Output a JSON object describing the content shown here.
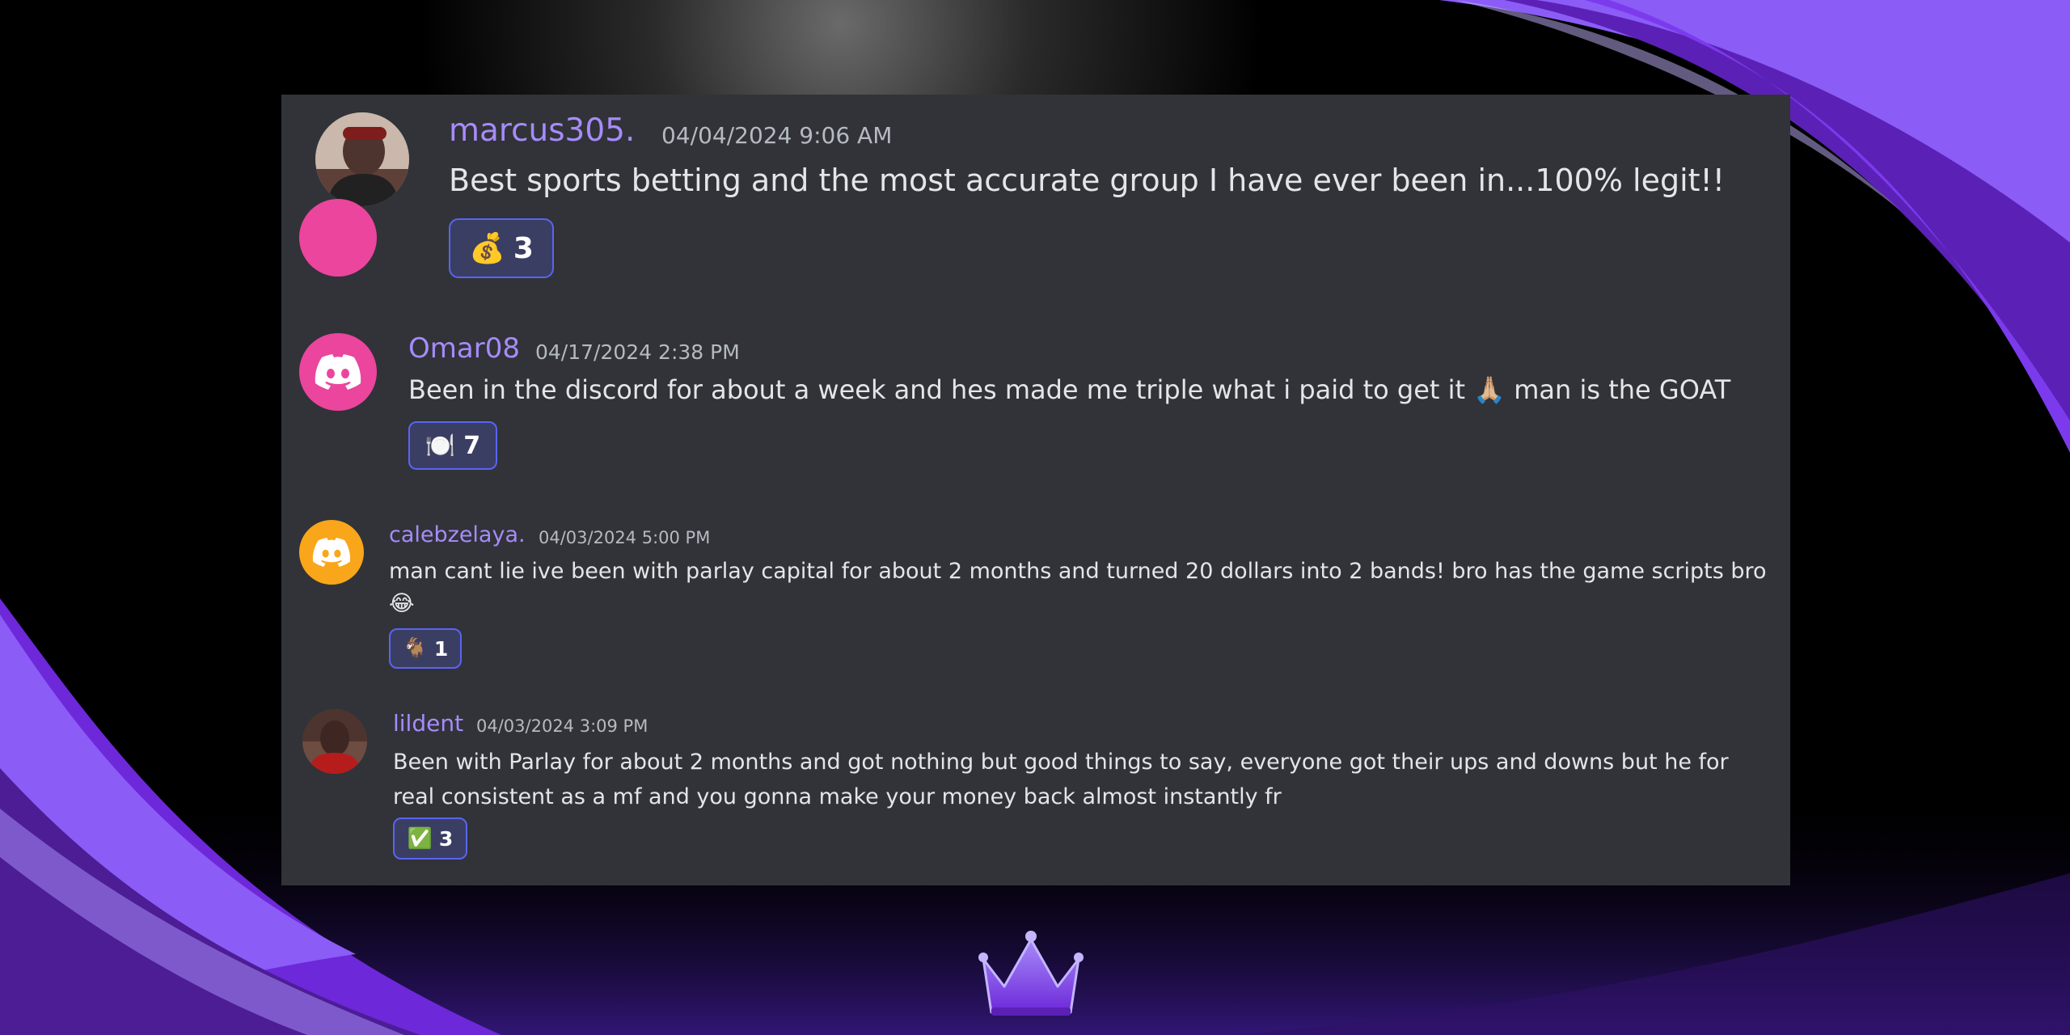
{
  "messages": [
    {
      "username": "marcus305.",
      "timestamp": "04/04/2024 9:06 AM",
      "text": "Best sports betting and the most accurate group I have ever been in...100% legit!!",
      "reaction": {
        "emoji": "💰",
        "count": "3"
      },
      "avatar_icon": "user-photo"
    },
    {
      "username": "Omar08",
      "timestamp": "04/17/2024 2:38 PM",
      "text": "Been in the discord for about a week and hes made me triple what i paid to get it 🙏🏼 man is the GOAT",
      "reaction": {
        "emoji": "🍽️",
        "count": "7"
      },
      "avatar_icon": "discord-logo",
      "avatar_color": "#eb459e"
    },
    {
      "username": "calebzelaya.",
      "timestamp": "04/03/2024 5:00 PM",
      "text": "man cant lie ive been with parlay capital for about 2 months and turned 20 dollars into 2 bands!  bro has the game scripts bro 😂",
      "reaction": {
        "emoji": "🐐",
        "count": "1"
      },
      "avatar_icon": "discord-logo",
      "avatar_color": "#faa61a"
    },
    {
      "username": "lildent",
      "timestamp": "04/03/2024 3:09 PM",
      "text": "Been with Parlay for about 2 months and got nothing but good things to say, everyone got their ups and downs but he for real consistent as a mf and you gonna make your money back almost instantly fr",
      "reaction": {
        "emoji": "✅",
        "count": "3"
      },
      "avatar_icon": "user-photo"
    }
  ],
  "logo_icon": "crown-icon",
  "colors": {
    "username": "#a78bfa",
    "card": "#313338",
    "reaction_border": "#5865f2",
    "accent_purple": "#6d28d9"
  }
}
